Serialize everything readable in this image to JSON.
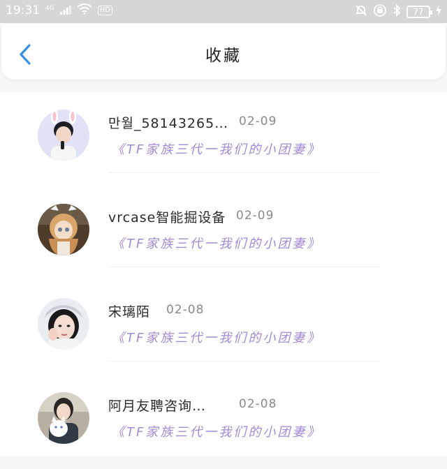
{
  "status_bar": {
    "time": "19:31",
    "signal": "4G",
    "network": "HD",
    "battery": "77"
  },
  "header": {
    "title": "收藏",
    "accent_color": "#3a8ee6"
  },
  "favorites": [
    {
      "name": "만월_58143265…",
      "date": "02-09",
      "topic": "《TF家族三代一我们的小团妻》"
    },
    {
      "name": "vrcase智能掘设备",
      "date": "02-09",
      "topic": "《TF家族三代一我们的小团妻》"
    },
    {
      "name": "宋璃陌",
      "date": "02-08",
      "topic": "《TF家族三代一我们的小团妻》"
    },
    {
      "name": "阿月友聘咨询…",
      "date": "02-08",
      "topic": "《TF家族三代一我们的小团妻》"
    }
  ]
}
